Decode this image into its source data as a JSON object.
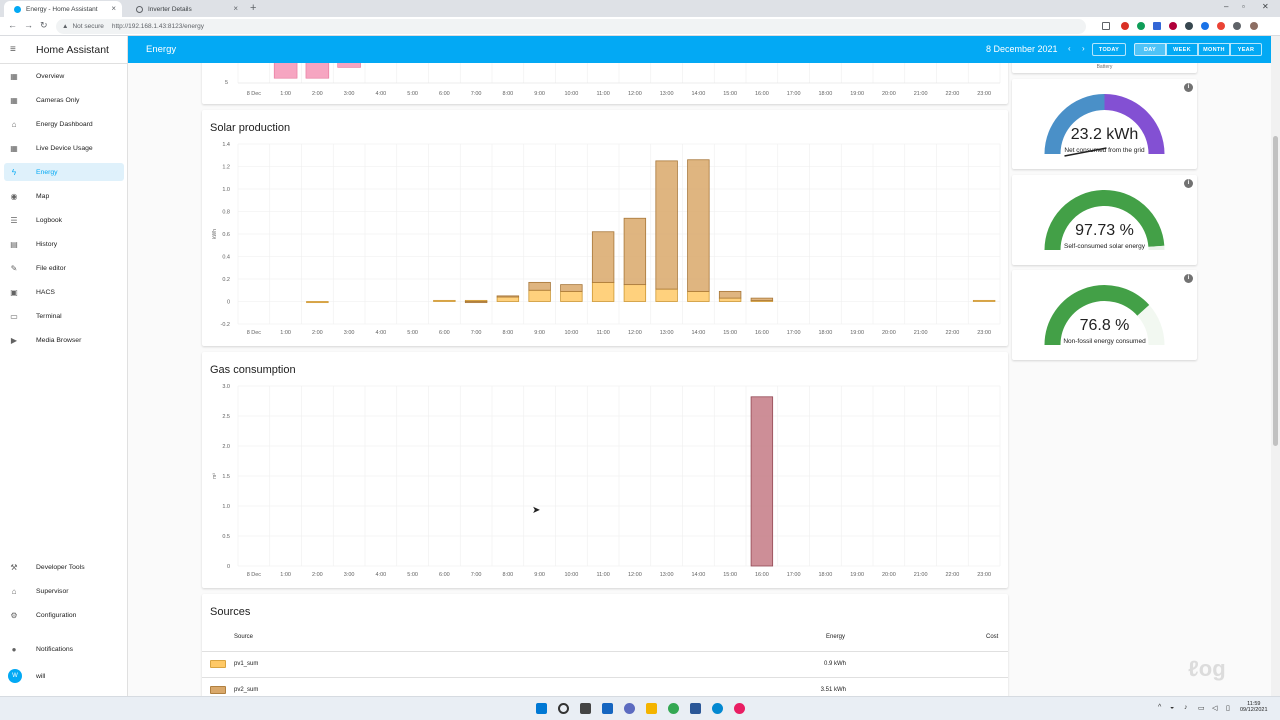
{
  "browser": {
    "tabs": [
      {
        "title": "Energy - Home Assistant",
        "active": true,
        "icon_color": "#03a9f4"
      },
      {
        "title": "Inverter Details",
        "active": false,
        "icon_color": "#5f6368"
      }
    ],
    "security_label": "Not secure",
    "url": "http://192.168.1.43:8123/energy"
  },
  "sidebar": {
    "app_title": "Home Assistant",
    "items": [
      {
        "label": "Overview",
        "icon": "grid-icon",
        "glyph": "▦"
      },
      {
        "label": "Cameras Only",
        "icon": "grid-icon",
        "glyph": "▦"
      },
      {
        "label": "Energy Dashboard",
        "icon": "home-battery-icon",
        "glyph": "⌂"
      },
      {
        "label": "Live Device Usage",
        "icon": "grid-icon",
        "glyph": "▦"
      },
      {
        "label": "Energy",
        "icon": "lightning-icon",
        "glyph": "ϟ",
        "selected": true
      },
      {
        "label": "Map",
        "icon": "map-pin-icon",
        "glyph": "◉"
      },
      {
        "label": "Logbook",
        "icon": "list-icon",
        "glyph": "☰"
      },
      {
        "label": "History",
        "icon": "chart-icon",
        "glyph": "▤"
      },
      {
        "label": "File editor",
        "icon": "wrench-icon",
        "glyph": "✎"
      },
      {
        "label": "HACS",
        "icon": "store-icon",
        "glyph": "▣"
      },
      {
        "label": "Terminal",
        "icon": "terminal-icon",
        "glyph": "▭"
      },
      {
        "label": "Media Browser",
        "icon": "media-icon",
        "glyph": "▶"
      }
    ],
    "bottom_items": [
      {
        "label": "Developer Tools",
        "icon": "hammer-icon",
        "glyph": "⚒"
      },
      {
        "label": "Supervisor",
        "icon": "home-assistant-icon",
        "glyph": "⌂"
      },
      {
        "label": "Configuration",
        "icon": "gear-icon",
        "glyph": "⚙"
      }
    ],
    "notifications_label": "Notifications",
    "user_label": "will",
    "user_initial": "W"
  },
  "toolbar": {
    "title": "Energy",
    "date": "8 December 2021",
    "today_label": "TODAY",
    "periods": [
      "DAY",
      "WEEK",
      "MONTH",
      "YEAR"
    ],
    "active_period": "DAY"
  },
  "hours": [
    "8 Dec",
    "1:00",
    "2:00",
    "3:00",
    "4:00",
    "5:00",
    "6:00",
    "7:00",
    "8:00",
    "9:00",
    "10:00",
    "11:00",
    "12:00",
    "13:00",
    "14:00",
    "15:00",
    "16:00",
    "17:00",
    "18:00",
    "19:00",
    "20:00",
    "21:00",
    "22:00",
    "23:00"
  ],
  "top_chart": {
    "visible_tick": "5",
    "values": [
      0,
      7,
      7,
      4,
      0,
      0,
      0,
      0,
      0,
      0,
      0,
      0,
      0,
      0,
      0,
      0,
      0,
      0,
      0,
      0,
      0,
      0,
      0,
      0
    ],
    "color": "#f48fb1"
  },
  "chart_data": [
    {
      "type": "bar",
      "title": "Solar production",
      "ylabel": "kWh",
      "ylim": [
        -0.2,
        1.4
      ],
      "yticks": [
        "-0.2",
        "0",
        "0.2",
        "0.4",
        "0.6",
        "0.8",
        "1.0",
        "1.2",
        "1.4"
      ],
      "ytick_values": [
        -0.2,
        0,
        0.2,
        0.4,
        0.6,
        0.8,
        1.0,
        1.2,
        1.4
      ],
      "stacked": true,
      "series": [
        {
          "color": "#ffc966",
          "values": [
            0,
            0,
            -0.01,
            0,
            0,
            0,
            0.01,
            0.01,
            0.04,
            0.1,
            0.09,
            0.17,
            0.15,
            0.11,
            0.09,
            0.03,
            0.01,
            0,
            0,
            0,
            0,
            0,
            0,
            0.01
          ]
        },
        {
          "color": "#d9a86a",
          "values": [
            0,
            0,
            0,
            0,
            0,
            0,
            0,
            -0.01,
            0.01,
            0.07,
            0.06,
            0.45,
            0.59,
            1.14,
            1.17,
            0.06,
            0.02,
            0,
            0,
            0,
            0,
            0,
            0,
            0
          ]
        }
      ]
    },
    {
      "type": "bar",
      "title": "Gas consumption",
      "ylabel": "m³",
      "ylim": [
        0,
        3.0
      ],
      "yticks": [
        "0",
        "0.5",
        "1.0",
        "1.5",
        "2.0",
        "2.5",
        "3.0"
      ],
      "ytick_values": [
        0,
        0.5,
        1.0,
        1.5,
        2.0,
        2.5,
        3.0
      ],
      "series": [
        {
          "color": "#c47a85",
          "values": [
            0,
            0,
            0,
            0,
            0,
            0,
            0,
            0,
            0,
            0,
            0,
            0,
            0,
            0,
            0,
            0,
            2.82,
            0,
            0,
            0,
            0,
            0,
            0,
            0
          ]
        }
      ]
    }
  ],
  "gauges": {
    "top_label": "Battery",
    "items": [
      {
        "value": "23.2 kWh",
        "label": "Net consumed from the grid",
        "fraction": 0.5,
        "color_a": "#4a90c8",
        "color_b": "#8350d3"
      },
      {
        "value": "97.73 %",
        "label": "Self-consumed solar energy",
        "fraction": 0.9773,
        "color_a": "#43a047",
        "color_b": "#eaf3ea"
      },
      {
        "value": "76.8 %",
        "label": "Non-fossil energy consumed",
        "fraction": 0.768,
        "color_a": "#43a047",
        "color_b": "#f2f8f1"
      }
    ]
  },
  "sources": {
    "title": "Sources",
    "headers": {
      "source": "Source",
      "energy": "Energy",
      "cost": "Cost"
    },
    "rows": [
      {
        "name": "pv1_sum",
        "energy": "0.9 kWh",
        "color": "#ffc966"
      },
      {
        "name": "pv2_sum",
        "energy": "3.51 kWh",
        "color": "#d9a86a"
      }
    ]
  },
  "taskbar": {
    "time": "11:59",
    "date": "09/12/2021"
  }
}
